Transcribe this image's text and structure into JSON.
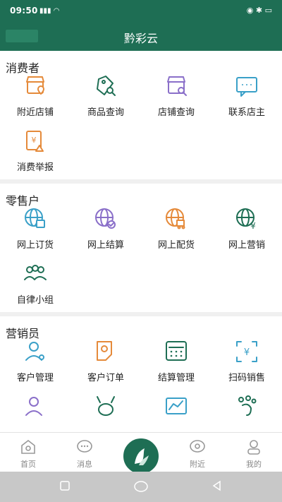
{
  "status_bar": {
    "time": "09:50",
    "signal": "▮▮▮ ◠"
  },
  "header": {
    "title": "黔彩云"
  },
  "sections": [
    {
      "title": "消费者",
      "items": [
        {
          "label": "附近店铺",
          "icon": "store-location-icon",
          "color": "#e58a3a"
        },
        {
          "label": "商品查询",
          "icon": "tag-search-icon",
          "color": "#1e6e54"
        },
        {
          "label": "店铺查询",
          "icon": "store-search-icon",
          "color": "#8a6fc9"
        },
        {
          "label": "联系店主",
          "icon": "chat-icon",
          "color": "#3aa0c8"
        },
        {
          "label": "消费举报",
          "icon": "report-icon",
          "color": "#e58a3a"
        }
      ]
    },
    {
      "title": "零售户",
      "items": [
        {
          "label": "网上订货",
          "icon": "globe-cart-icon",
          "color": "#3aa0c8"
        },
        {
          "label": "网上结算",
          "icon": "globe-check-icon",
          "color": "#8a6fc9"
        },
        {
          "label": "网上配货",
          "icon": "globe-truck-icon",
          "color": "#e58a3a"
        },
        {
          "label": "网上营销",
          "icon": "globe-yen-icon",
          "color": "#1e6e54"
        },
        {
          "label": "自律小组",
          "icon": "group-icon",
          "color": "#1e6e54"
        }
      ]
    },
    {
      "title": "营销员",
      "items": [
        {
          "label": "客户管理",
          "icon": "user-gear-icon",
          "color": "#3aa0c8"
        },
        {
          "label": "客户订单",
          "icon": "order-gear-icon",
          "color": "#e58a3a"
        },
        {
          "label": "结算管理",
          "icon": "calculator-icon",
          "color": "#1e6e54"
        },
        {
          "label": "扫码销售",
          "icon": "scan-yen-icon",
          "color": "#3aa0c8"
        },
        {
          "label": "",
          "icon": "user-icon",
          "color": "#8a6fc9"
        },
        {
          "label": "",
          "icon": "antenna-icon",
          "color": "#1e6e54"
        },
        {
          "label": "",
          "icon": "chart-icon",
          "color": "#3aa0c8"
        },
        {
          "label": "",
          "icon": "footprint-icon",
          "color": "#1e6e54"
        }
      ]
    }
  ],
  "tabs": [
    {
      "label": "首页",
      "icon": "home-icon"
    },
    {
      "label": "消息",
      "icon": "message-icon"
    },
    {
      "label": "附近",
      "icon": "location-icon"
    },
    {
      "label": "我的",
      "icon": "profile-icon"
    }
  ]
}
